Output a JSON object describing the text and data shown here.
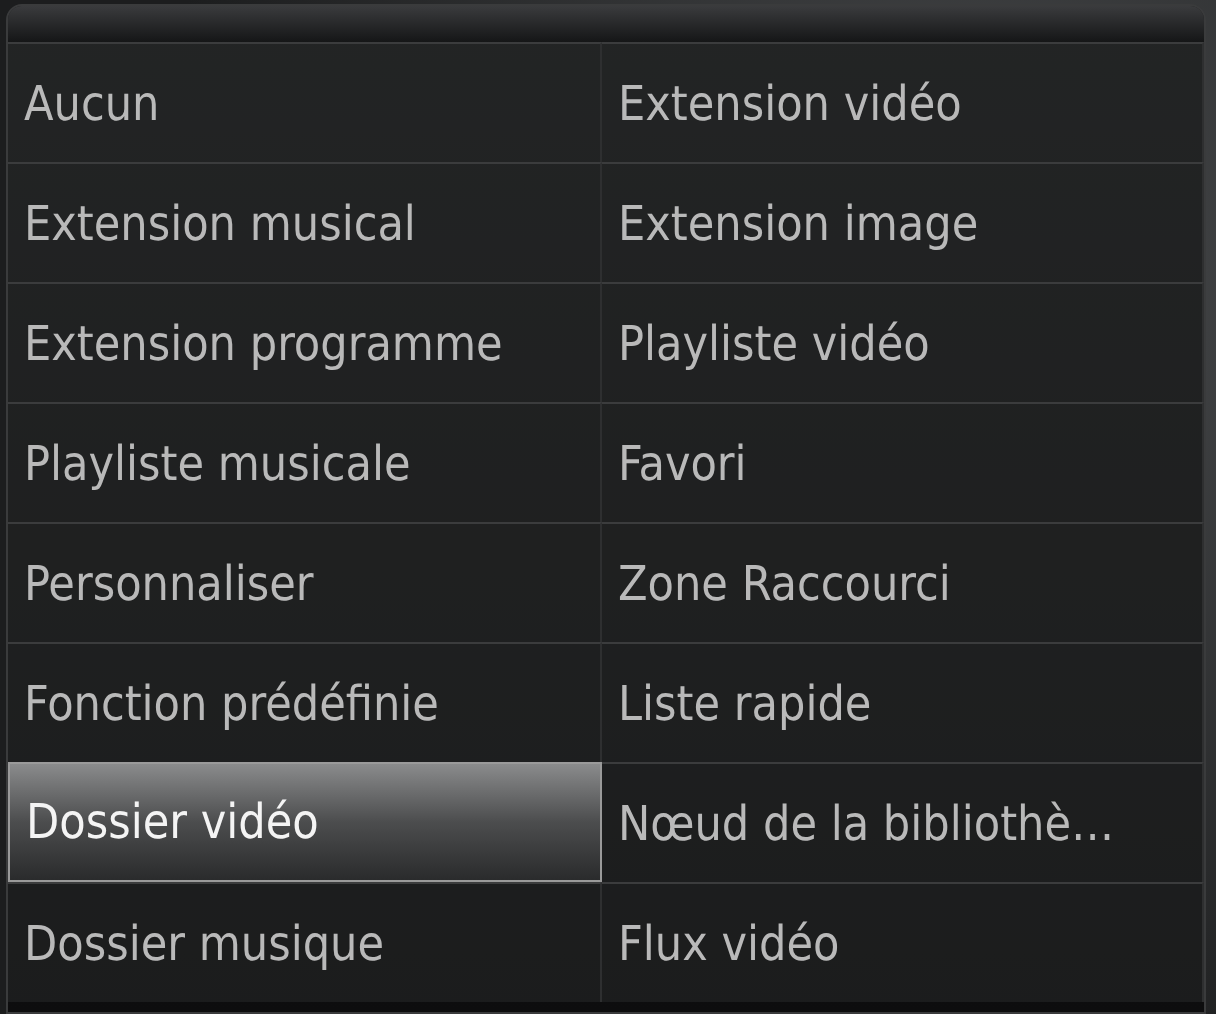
{
  "options": [
    {
      "label": "Aucun",
      "selected": false
    },
    {
      "label": "Extension vidéo",
      "selected": false
    },
    {
      "label": "Extension musical",
      "selected": false
    },
    {
      "label": "Extension image",
      "selected": false
    },
    {
      "label": "Extension programme",
      "selected": false
    },
    {
      "label": "Playliste vidéo",
      "selected": false
    },
    {
      "label": "Playliste musicale",
      "selected": false
    },
    {
      "label": "Favori",
      "selected": false
    },
    {
      "label": "Personnaliser",
      "selected": false
    },
    {
      "label": "Zone Raccourci",
      "selected": false
    },
    {
      "label": "Fonction prédéfinie",
      "selected": false
    },
    {
      "label": "Liste rapide",
      "selected": false
    },
    {
      "label": "Dossier vidéo",
      "selected": true
    },
    {
      "label": "Nœud de la bibliothè…",
      "selected": false
    },
    {
      "label": "Dossier musique",
      "selected": false
    },
    {
      "label": "Flux vidéo",
      "selected": false
    }
  ]
}
